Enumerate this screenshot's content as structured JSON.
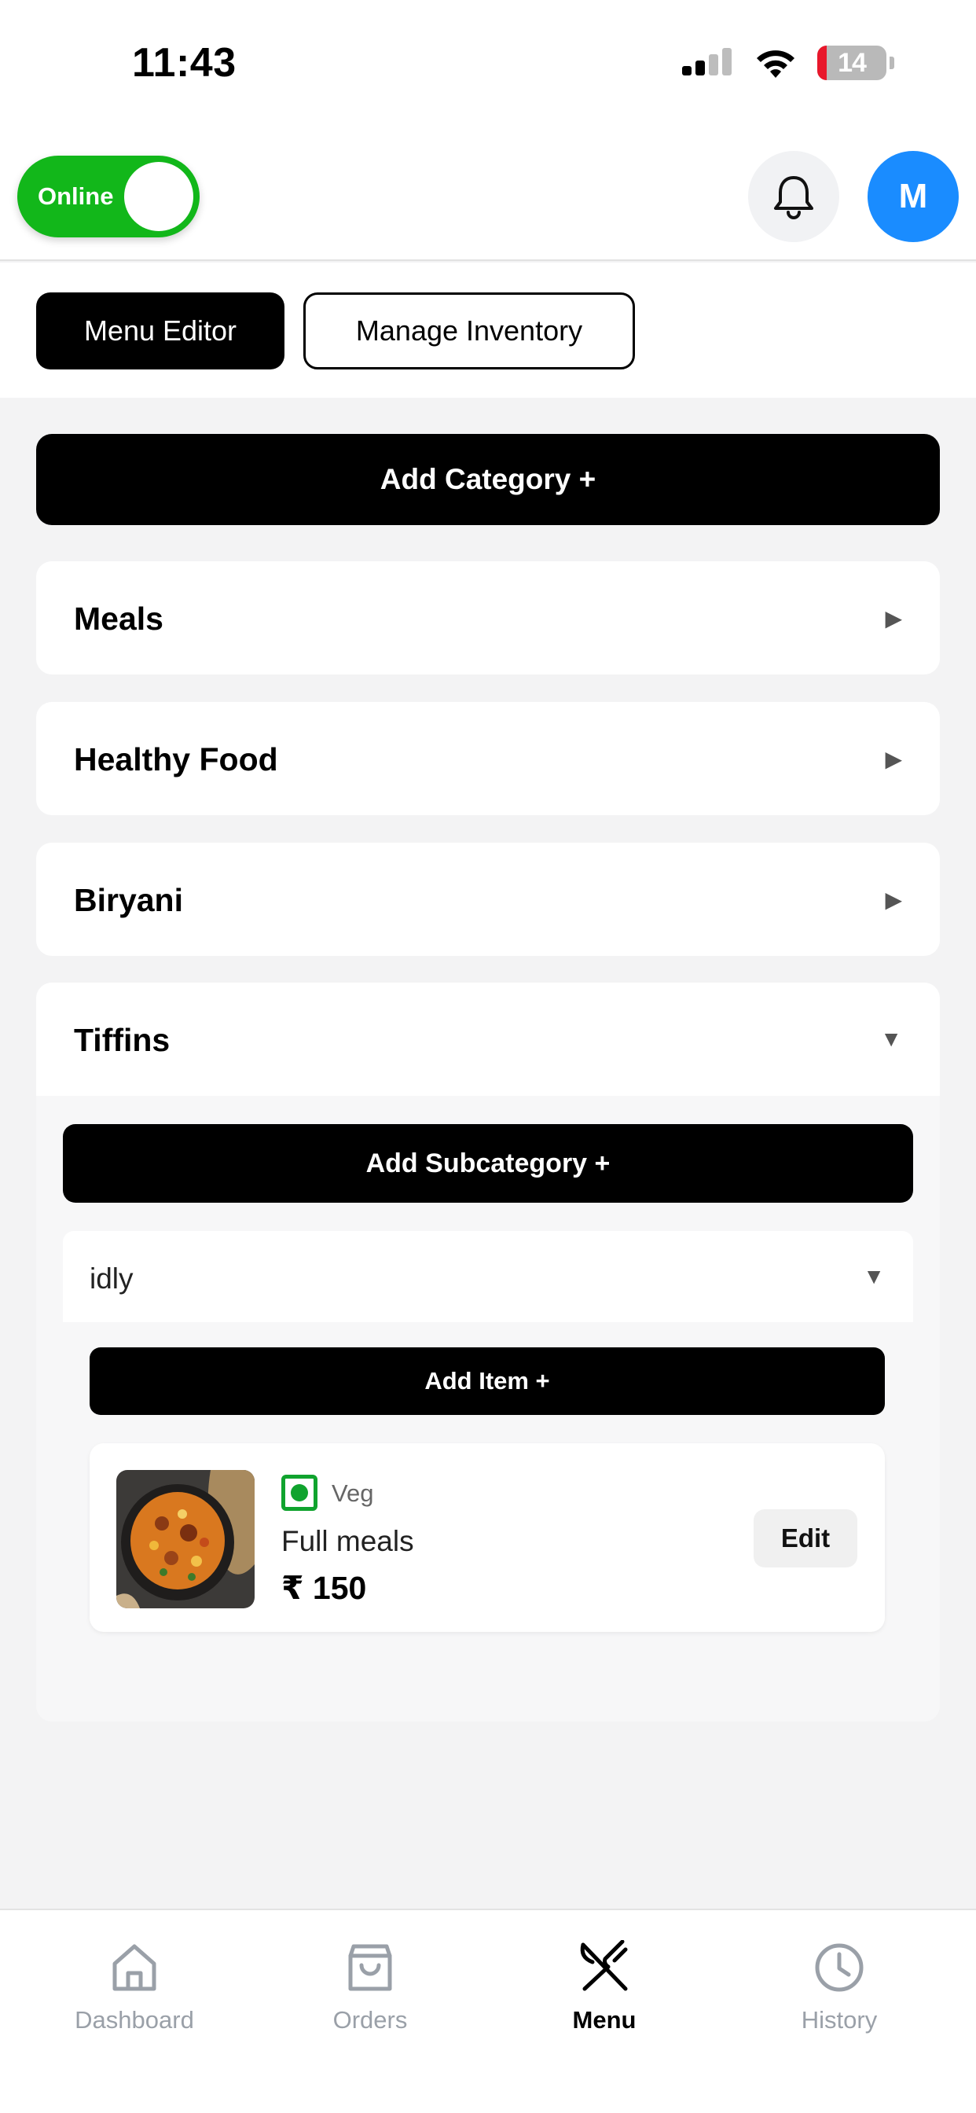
{
  "status_bar": {
    "time": "11:43",
    "battery": "14"
  },
  "header": {
    "online_label": "Online",
    "avatar_initial": "M"
  },
  "tabs": [
    {
      "label": "Menu Editor",
      "active": true
    },
    {
      "label": "Manage Inventory",
      "active": false
    }
  ],
  "menu": {
    "add_category_label": "Add Category +",
    "categories": [
      {
        "name": "Meals",
        "expanded": false
      },
      {
        "name": "Healthy Food",
        "expanded": false
      },
      {
        "name": "Biryani",
        "expanded": false
      },
      {
        "name": "Tiffins",
        "expanded": true
      }
    ],
    "add_subcategory_label": "Add Subcategory +",
    "subcategory": {
      "name": "idly",
      "expanded": true
    },
    "add_item_label": "Add Item +",
    "item": {
      "type": "Veg",
      "name": "Full meals",
      "price": "₹ 150",
      "edit_label": "Edit"
    },
    "arrow_collapsed": "▶",
    "arrow_expanded": "▼"
  },
  "bottom_nav": [
    {
      "label": "Dashboard",
      "icon": "home-icon",
      "active": false
    },
    {
      "label": "Orders",
      "icon": "shopping-bag-icon",
      "active": false
    },
    {
      "label": "Menu",
      "icon": "fork-knife-icon",
      "active": true
    },
    {
      "label": "History",
      "icon": "clock-icon",
      "active": false
    }
  ],
  "colors": {
    "online_green": "#12b71a",
    "avatar_blue": "#1a8cff",
    "veg_green": "#10a32e",
    "battery_red": "#e8172b"
  }
}
